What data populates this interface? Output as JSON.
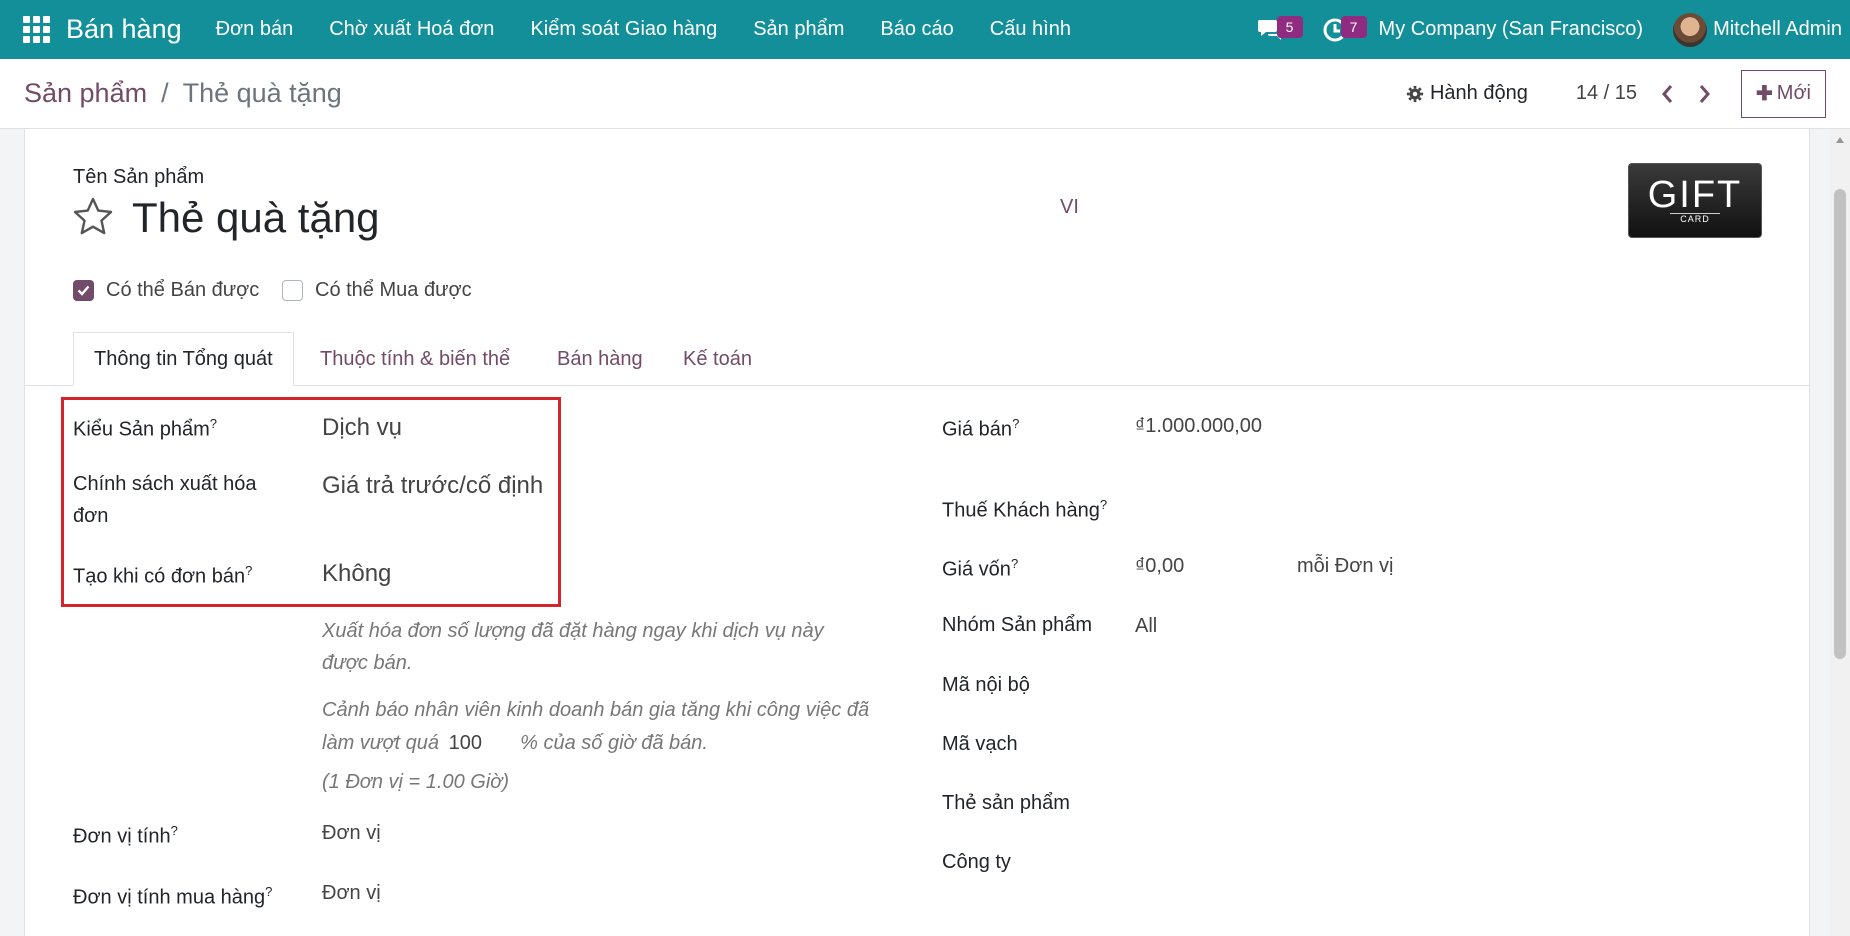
{
  "topbar": {
    "app_name": "Bán hàng",
    "menu": [
      "Đơn bán",
      "Chờ xuất Hoá đơn",
      "Kiểm soát Giao hàng",
      "Sản phẩm",
      "Báo cáo",
      "Cấu hình"
    ],
    "messages_count": "5",
    "activities_count": "7",
    "company": "My Company (San Francisco)",
    "user": "Mitchell Admin"
  },
  "controlbar": {
    "breadcrumb_parent": "Sản phẩm",
    "breadcrumb_separator": "/",
    "breadcrumb_current": "Thẻ quà tặng",
    "action_label": "Hành động",
    "pager": "14 / 15",
    "new_label": "Mới"
  },
  "form": {
    "name_label": "Tên Sản phẩm",
    "product_name": "Thẻ quà tặng",
    "lang": "VI",
    "image_text_big": "GIFT",
    "image_text_small": "CARD",
    "can_be_sold_label": "Có thể Bán được",
    "can_be_sold": true,
    "can_be_purchased_label": "Có thể Mua được",
    "can_be_purchased": false,
    "tabs": [
      "Thông tin Tổng quát",
      "Thuộc tính & biến thể",
      "Bán hàng",
      "Kế toán"
    ],
    "left": {
      "product_type_label": "Kiểu Sản phẩm",
      "product_type": "Dịch vụ",
      "invoice_policy_label_1": "Chính sách xuất hóa",
      "invoice_policy_label_2": "đơn",
      "invoice_policy": "Giá trả trước/cố định",
      "create_on_order_label": "Tạo khi có đơn bán",
      "create_on_order": "Không",
      "note1_line1": "Xuất hóa đơn số lượng đã đặt hàng ngay khi dịch vụ này",
      "note1_line2": "được bán.",
      "note2_line1": "Cảnh báo nhân viên kinh doanh bán gia tăng khi công việc đã",
      "note2_prefix": "làm vượt quá",
      "note2_value": "100",
      "note2_suffix": "% của số giờ đã bán.",
      "note3": "(1 Đơn vị = 1.00 Giờ)",
      "uom_label": "Đơn vị tính",
      "uom": "Đơn vị",
      "purchase_uom_label": "Đơn vị tính mua hàng",
      "purchase_uom": "Đơn vị"
    },
    "right": {
      "sale_price_label": "Giá bán",
      "sale_price": "₫1.000.000,00",
      "customer_tax_label": "Thuế Khách hàng",
      "cost_label": "Giá vốn",
      "cost": "₫0,00",
      "cost_per": "mỗi Đơn vị",
      "category_label": "Nhóm Sản phẩm",
      "category": "All",
      "internal_ref_label": "Mã nội bộ",
      "barcode_label": "Mã vạch",
      "tags_label": "Thẻ sản phẩm",
      "company_label": "Công ty"
    },
    "help_mark": "?"
  }
}
